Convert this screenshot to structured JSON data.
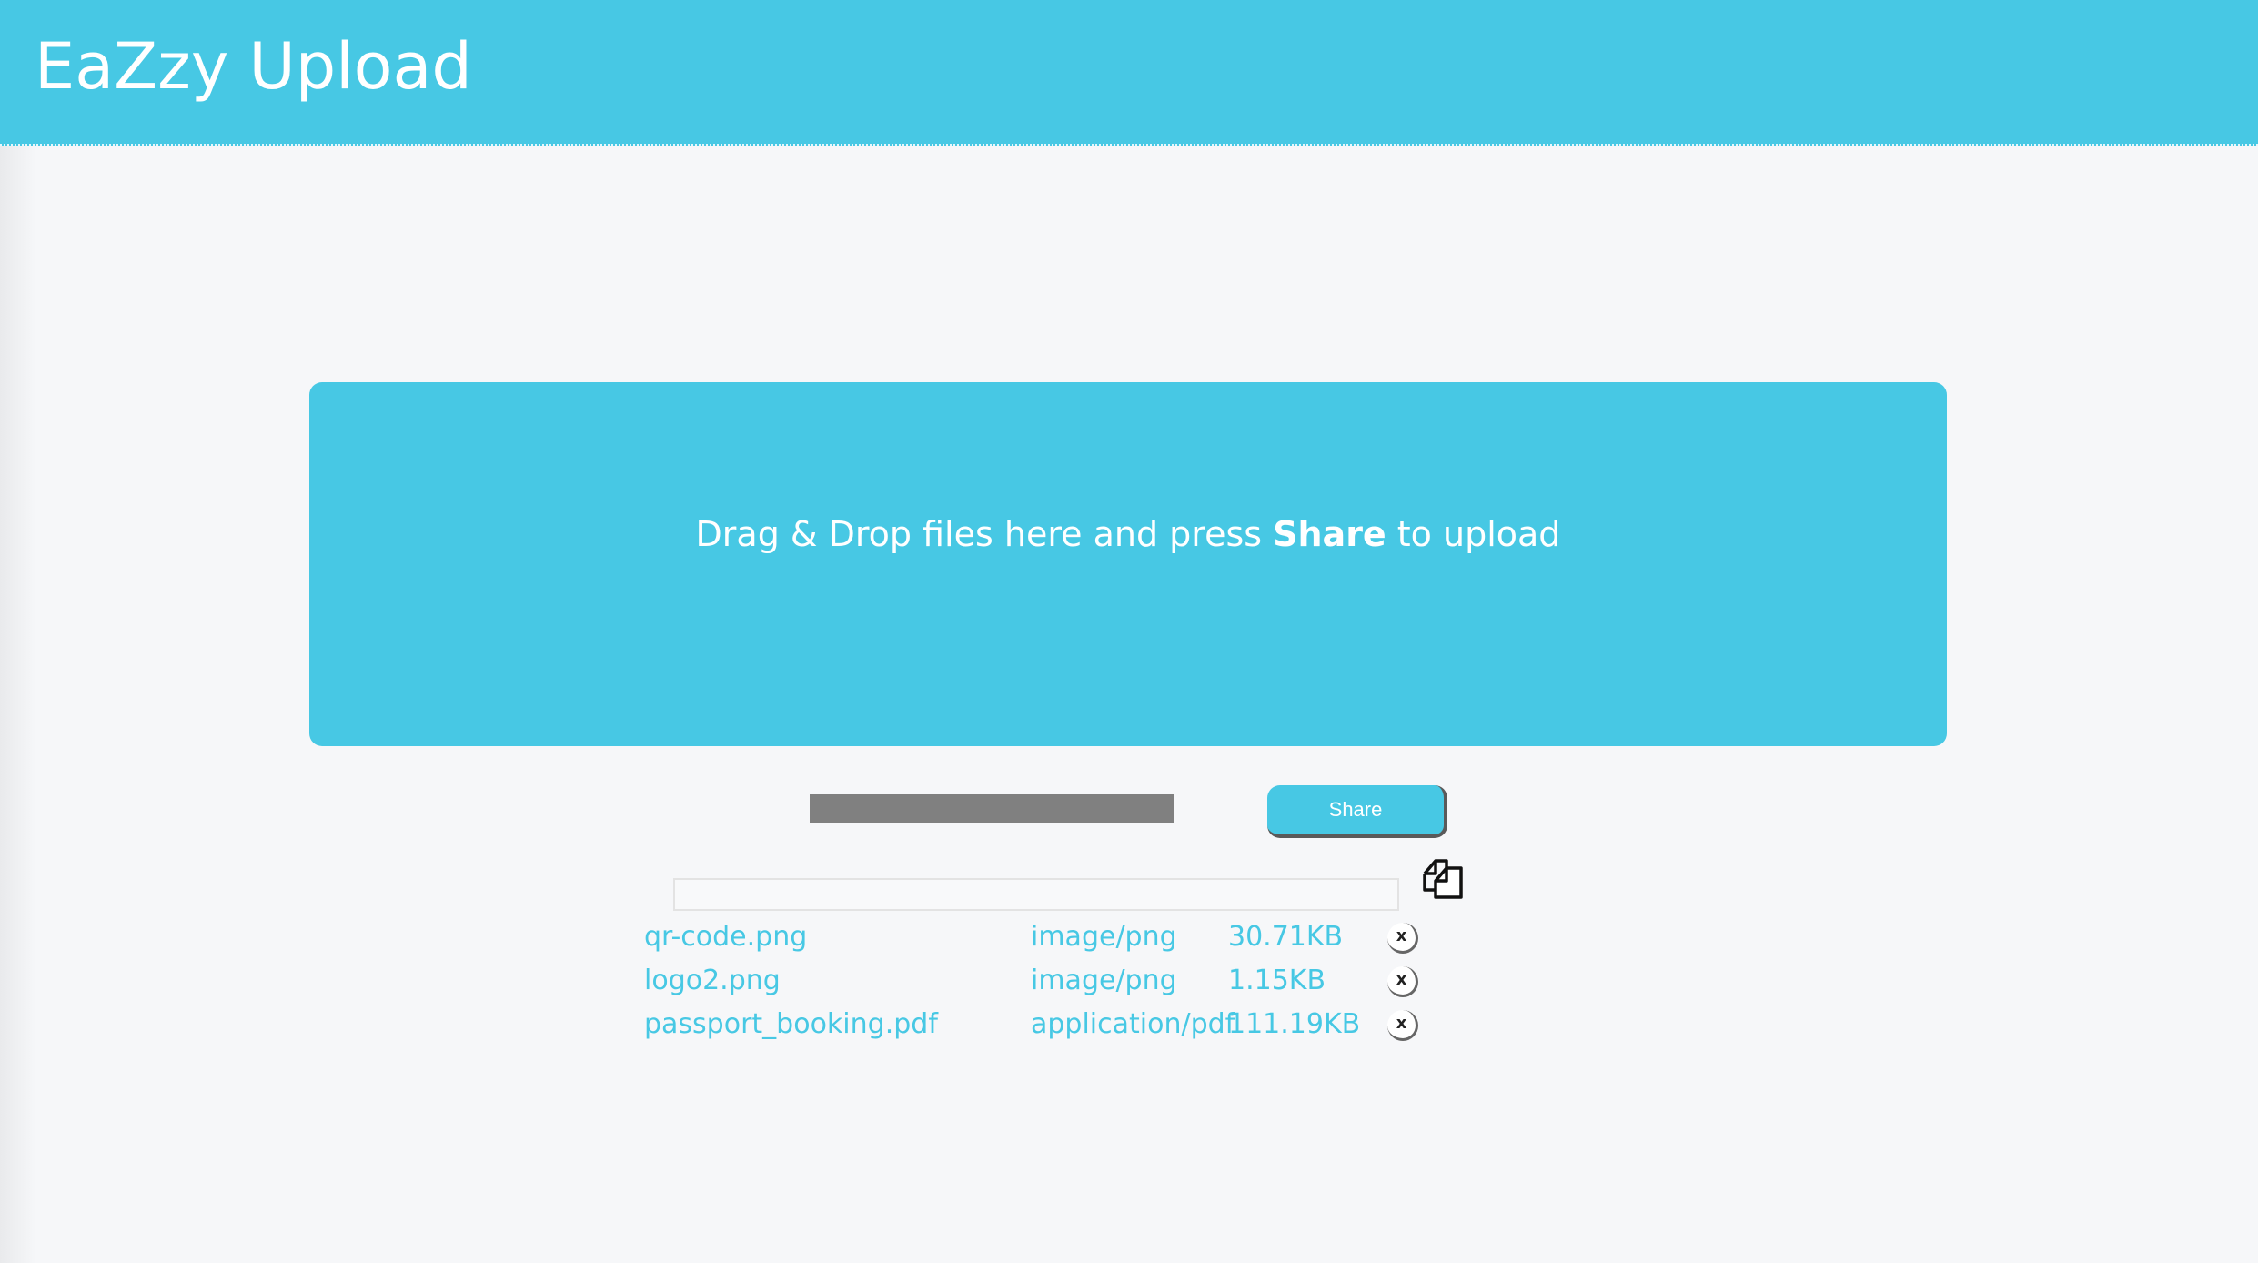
{
  "app": {
    "title": "EaZzy Upload"
  },
  "dropzone": {
    "text_before": "Drag & Drop files here and press ",
    "text_strong": "Share",
    "text_after": " to upload"
  },
  "upload": {
    "progress": 1.0,
    "share_label": "Share",
    "link_value": ""
  },
  "files": [
    {
      "name": "qr-code.png",
      "type": "image/png",
      "size": "30.71KB",
      "remove_label": "x"
    },
    {
      "name": "logo2.png",
      "type": "image/png",
      "size": "1.15KB",
      "remove_label": "x"
    },
    {
      "name": "passport_booking.pdf",
      "type": "application/pdf",
      "size": "111.19KB",
      "remove_label": "x"
    }
  ],
  "icons": {
    "copy": "copy-icon",
    "remove": "close-icon"
  },
  "colors": {
    "accent": "#47c8e4",
    "background": "#f6f7f9",
    "progress": "#808080"
  }
}
